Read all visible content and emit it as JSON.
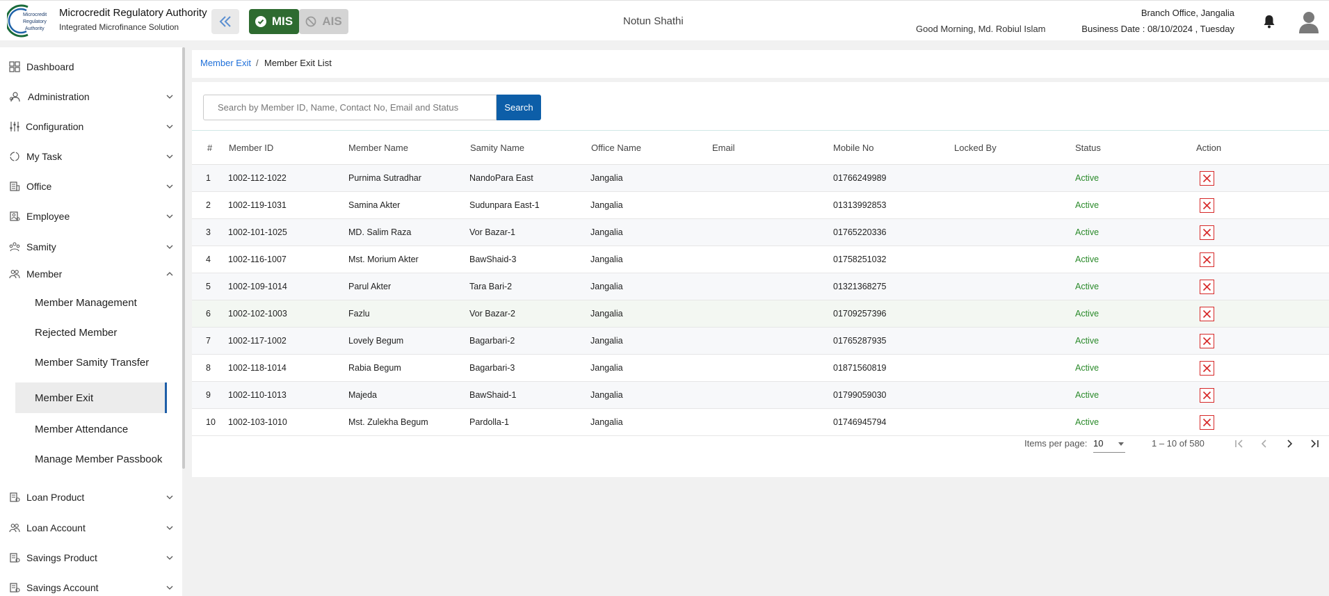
{
  "header": {
    "logo_text": "Microcredit Regulatory Authority",
    "brand_title": "Microcredit Regulatory Authority",
    "brand_subtitle": "Integrated Microfinance Solution",
    "mis_label": "MIS",
    "ais_label": "AIS",
    "org_name": "Notun Shathi",
    "greeting": "Good Morning, Md. Robiul Islam",
    "branch": "Branch Office, Jangalia",
    "business_date": "Business Date : 08/10/2024 , Tuesday"
  },
  "sidebar": {
    "items": [
      {
        "label": "Dashboard",
        "icon": "dashboard-icon"
      },
      {
        "label": "Administration",
        "icon": "admin-icon"
      },
      {
        "label": "Configuration",
        "icon": "sliders-icon"
      },
      {
        "label": "My Task",
        "icon": "task-icon"
      },
      {
        "label": "Office",
        "icon": "office-icon"
      },
      {
        "label": "Employee",
        "icon": "employee-icon"
      },
      {
        "label": "Samity",
        "icon": "samity-icon"
      },
      {
        "label": "Member",
        "icon": "member-icon"
      }
    ],
    "member_sub": [
      "Member Management",
      "Rejected Member",
      "Member Samity Transfer",
      "Member Exit",
      "Member Attendance",
      "Manage Member Passbook"
    ],
    "bottom_items": [
      {
        "label": "Loan Product",
        "icon": "loan-product-icon"
      },
      {
        "label": "Loan Account",
        "icon": "loan-account-icon"
      },
      {
        "label": "Savings Product",
        "icon": "savings-product-icon"
      },
      {
        "label": "Savings Account",
        "icon": "savings-account-icon"
      }
    ]
  },
  "breadcrumb": {
    "parent": "Member Exit",
    "separator": "/",
    "current": "Member Exit List"
  },
  "search": {
    "placeholder": "Search by Member ID, Name, Contact No, Email and Status",
    "button": "Search"
  },
  "table": {
    "headers": [
      "#",
      "Member ID",
      "Member Name",
      "Samity Name",
      "Office Name",
      "Email",
      "Mobile No",
      "Locked By",
      "Status",
      "Action"
    ],
    "rows": [
      {
        "n": "1",
        "id": "1002-112-1022",
        "name": "Purnima Sutradhar",
        "samity": "NandoPara East",
        "office": "Jangalia",
        "email": "",
        "mobile": "01766249989",
        "locked": "",
        "status": "Active"
      },
      {
        "n": "2",
        "id": "1002-119-1031",
        "name": "Samina Akter",
        "samity": "Sudunpara East-1",
        "office": "Jangalia",
        "email": "",
        "mobile": "01313992853",
        "locked": "",
        "status": "Active"
      },
      {
        "n": "3",
        "id": "1002-101-1025",
        "name": "MD. Salim Raza",
        "samity": "Vor Bazar-1",
        "office": "Jangalia",
        "email": "",
        "mobile": "01765220336",
        "locked": "",
        "status": "Active"
      },
      {
        "n": "4",
        "id": "1002-116-1007",
        "name": "Mst. Morium Akter",
        "samity": "BawShaid-3",
        "office": "Jangalia",
        "email": "",
        "mobile": "01758251032",
        "locked": "",
        "status": "Active"
      },
      {
        "n": "5",
        "id": "1002-109-1014",
        "name": "Parul Akter",
        "samity": "Tara Bari-2",
        "office": "Jangalia",
        "email": "",
        "mobile": "01321368275",
        "locked": "",
        "status": "Active"
      },
      {
        "n": "6",
        "id": "1002-102-1003",
        "name": "Fazlu",
        "samity": "Vor Bazar-2",
        "office": "Jangalia",
        "email": "",
        "mobile": "01709257396",
        "locked": "",
        "status": "Active"
      },
      {
        "n": "7",
        "id": "1002-117-1002",
        "name": "Lovely Begum",
        "samity": "Bagarbari-2",
        "office": "Jangalia",
        "email": "",
        "mobile": "01765287935",
        "locked": "",
        "status": "Active"
      },
      {
        "n": "8",
        "id": "1002-118-1014",
        "name": "Rabia Begum",
        "samity": "Bagarbari-3",
        "office": "Jangalia",
        "email": "",
        "mobile": "01871560819",
        "locked": "",
        "status": "Active"
      },
      {
        "n": "9",
        "id": "1002-110-1013",
        "name": "Majeda",
        "samity": "BawShaid-1",
        "office": "Jangalia",
        "email": "",
        "mobile": "01799059030",
        "locked": "",
        "status": "Active"
      },
      {
        "n": "10",
        "id": "1002-103-1010",
        "name": "Mst. Zulekha Begum",
        "samity": "Pardolla-1",
        "office": "Jangalia",
        "email": "",
        "mobile": "01746945794",
        "locked": "",
        "status": "Active"
      }
    ]
  },
  "paginator": {
    "items_label": "Items per page:",
    "page_size": "10",
    "range": "1 – 10 of 580"
  },
  "colors": {
    "mis_green": "#2e6b30",
    "primary_blue": "#0d5ea8",
    "status_green": "#2a8a2a",
    "delete_red": "#d62828"
  }
}
